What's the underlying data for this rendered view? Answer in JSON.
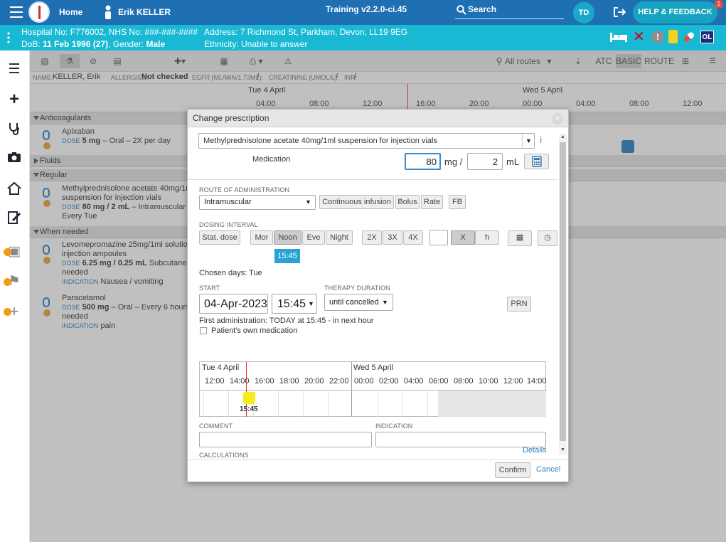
{
  "topbar": {
    "home_label": "Home",
    "user_name": "Erik KELLER",
    "training_label": "Training v2.2.0-ci.45",
    "search_label": "Search",
    "user_initials": "TD",
    "help_label": "HELP & FEEDBACK",
    "help_badge": "1",
    "colors": {
      "bar": "#1f6fb3",
      "banner": "#1ab9d3"
    }
  },
  "patient": {
    "line1_left": "Hospital No: F776002, NHS No: ###-###-####",
    "line1_right": "Address: 7 Richmond St, Parkham, Devon, LL19 9EG",
    "line2_left_prefix": "DoB: ",
    "dob": "11 Feb 1996 (27)",
    "gender_prefix": ", Gender: ",
    "gender": "Male",
    "ethnicity": "Ethnicity: Unable to answer",
    "ol_badge": "OL"
  },
  "toolbar": {
    "all_routes": "All routes",
    "atc": "ATC",
    "basic": "BASIC",
    "route": "ROUTE"
  },
  "info_strip": {
    "name_label": "NAME:",
    "name": "KELLER, Erik",
    "allergies_label": "ALLERGIES:",
    "allergies": "Not checked",
    "egfr_label": "EGFR (ML/MIN/1.73M2):",
    "egfr": "/",
    "creatinine_label": "CREATININE (UMOL/L):",
    "creatinine": "/",
    "inr_label": "INR:",
    "inr": "/"
  },
  "timeline": {
    "day1": "Tue 4 April",
    "day2": "Wed 5 April",
    "hours": [
      "04:00",
      "08:00",
      "12:00",
      "16:00",
      "20:00",
      "00:00",
      "04:00",
      "08:00",
      "12:00"
    ]
  },
  "drug_list": {
    "categories": [
      "Anticoagulants",
      "Fluids",
      "Regular",
      "When needed"
    ],
    "apixaban": {
      "name": "Apixaban",
      "dose_label": "DOSE",
      "dose": "5 mg",
      "route": " – Oral – 2X per day"
    },
    "methyl": {
      "line1": "Methylprednisolone acetate 40mg/1m",
      "line2": "suspension for injection vials",
      "dose_label": "DOSE",
      "dose": "80 mg / 2 mL",
      "route": " – Intramuscular -",
      "line4": "Every Tue"
    },
    "levo": {
      "line1": "Levomepromazine 25mg/1ml solution",
      "line2": "injection ampoules",
      "dose_label": "DOSE",
      "dose": "6.25 mg / 0.25 mL",
      "route": " Subcutaneous",
      "line4": "needed",
      "ind_label": "INDICATION",
      "indication": "Nausea / vomiting"
    },
    "para": {
      "name": "Paracetamol",
      "dose_label": "DOSE",
      "dose": "500 mg",
      "route": " – Oral – Every 6 hours –",
      "line3": "needed",
      "ind_label": "INDICATION",
      "indication": "pain"
    }
  },
  "dialog": {
    "title": "Change prescription",
    "close": "×",
    "medication_select": "Methylprednisolone acetate 40mg/1ml suspension for injection vials",
    "medication_label": "Medication",
    "dose_value": "80",
    "dose_unit": "mg /",
    "volume_value": "2",
    "volume_unit": "mL",
    "route_label": "ROUTE OF ADMINISTRATION",
    "route_value": "Intramuscular",
    "route_buttons": [
      "Continuous infusion",
      "Bolus",
      "Rate",
      "FB"
    ],
    "dosing_label": "DOSING INTERVAL",
    "stat_dose": "Stat. dose",
    "times": [
      "Mor",
      "Noon",
      "Eve",
      "Night"
    ],
    "selected_time": "Noon",
    "freq": [
      "2X",
      "3X",
      "4X"
    ],
    "x_label": "X",
    "h_label": "h",
    "noon_time": "15:45",
    "chosen_days": "Chosen days: Tue",
    "start_label": "START",
    "start_date": "04-Apr-2023",
    "start_time": "15:45",
    "therapy_label": "THERAPY DURATION",
    "therapy_value": "until cancelled",
    "prn": "PRN",
    "first_admin": "First administration: TODAY at 15:45 - in next hour",
    "own_med": "Patient's own medication",
    "grid_day1": "Tue 4 April",
    "grid_day2": "Wed 5 April",
    "grid_hours": [
      "12:00",
      "14:00",
      "16:00",
      "18:00",
      "20:00",
      "22:00",
      "00:00",
      "02:00",
      "04:00",
      "06:00",
      "08:00",
      "10:00",
      "12:00",
      "14:00"
    ],
    "grid_marker": "15:45",
    "comment_label": "COMMENT",
    "indication_label": "INDICATION",
    "calculations_label": "CALCULATIONS",
    "details": "Details",
    "confirm": "Confirm",
    "cancel": "Cancel"
  }
}
